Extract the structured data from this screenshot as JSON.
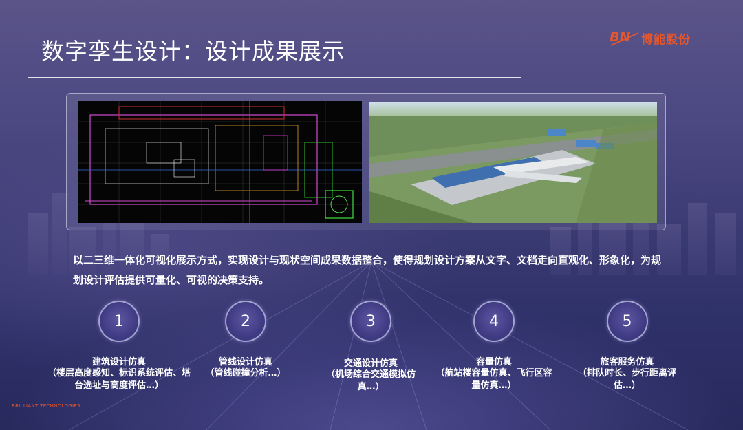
{
  "header": {
    "title": "数字孪生设计：设计成果展示",
    "logo_text": "博能股份"
  },
  "images": {
    "cad_plan": "cad-drawing-image",
    "aerial_render": "airport-3d-rendering-image"
  },
  "description": "以二三维一体化可视化展示方式，实现设计与现状空间成果数据整合，使得规划设计方案从文字、文档走向直观化、形象化，为规划设计评估提供可量化、可视的决策支持。",
  "steps": [
    {
      "number": "1",
      "title": "建筑设计仿真",
      "desc": "（楼层高度感知、标识系统评估、塔台选址与高度评估…）"
    },
    {
      "number": "2",
      "title": "管线设计仿真",
      "desc": "（管线碰撞分析…）"
    },
    {
      "number": "3",
      "title": "交通设计仿真",
      "desc": "（机场综合交通模拟仿真…）"
    },
    {
      "number": "4",
      "title": "容量仿真",
      "desc": "（航站楼容量仿真、飞行区容量仿真…）"
    },
    {
      "number": "5",
      "title": "旅客服务仿真",
      "desc": "（排队时长、步行距离评估…）"
    }
  ],
  "footer": {
    "company": "BRILLIANT TECHNOLOGIES"
  },
  "colors": {
    "accent": "#e4572e",
    "background": "#3a3a72"
  }
}
